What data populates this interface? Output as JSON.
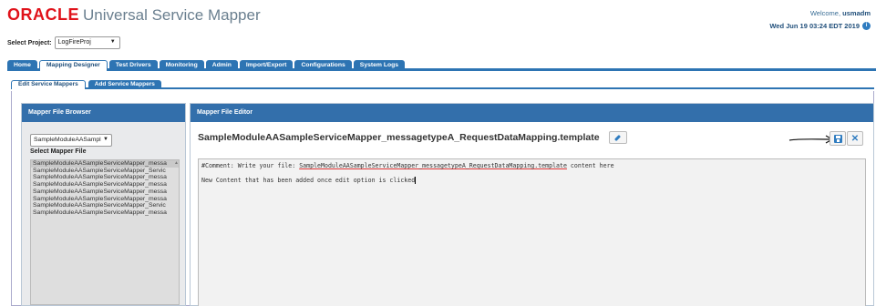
{
  "header": {
    "brand": "ORACLE",
    "app_title": "Universal Service Mapper",
    "welcome_label": "Welcome,",
    "username": "usmadm",
    "datetime": "Wed Jun 19 03:24 EDT 2019",
    "info_icon": "info-icon"
  },
  "project": {
    "label": "Select Project:",
    "value": "LogFireProj"
  },
  "tabs": [
    {
      "label": "Home"
    },
    {
      "label": "Mapping Designer",
      "active": true
    },
    {
      "label": "Test Drivers"
    },
    {
      "label": "Monitoring"
    },
    {
      "label": "Admin"
    },
    {
      "label": "Import/Export"
    },
    {
      "label": "Configurations"
    },
    {
      "label": "System Logs"
    }
  ],
  "subtabs": [
    {
      "label": "Edit Service Mappers",
      "active": true
    },
    {
      "label": "Add Service Mappers"
    }
  ],
  "browser": {
    "title": "Mapper File Browser",
    "module_select": "SampleModuleAASampl",
    "file_label": "Select Mapper File",
    "files": [
      "SampleModuleAASampleServiceMapper_messa",
      "SampleModuleAASampleServiceMapper_Servic",
      "SampleModuleAASampleServiceMapper_messa",
      "SampleModuleAASampleServiceMapper_messa",
      "SampleModuleAASampleServiceMapper_messa",
      "SampleModuleAASampleServiceMapper_messa",
      "SampleModuleAASampleServiceMapper_Servic",
      "SampleModuleAASampleServiceMapper_messa"
    ]
  },
  "editor": {
    "title": "Mapper File Editor",
    "file_name": "SampleModuleAASampleServiceMapper_messagetypeA_RequestDataMapping.template",
    "line1_prefix": "#Comment: Write your file: ",
    "line1_file": "SampleModuleAASampleServiceMapper_messagetypeA_RequestDataMapping.template",
    "line1_suffix": " content here",
    "line2": "New Content that has been added once edit option is clicked"
  },
  "colors": {
    "brand_red": "#e0121a",
    "tab_blue": "#2d74b3",
    "panel_header": "#336fab"
  }
}
